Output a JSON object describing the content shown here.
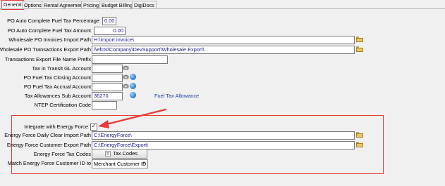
{
  "tabs": [
    {
      "label": "General",
      "active": true
    },
    {
      "label": "Options",
      "active": false
    },
    {
      "label": "Rental Agreement",
      "active": false
    },
    {
      "label": "Pricing",
      "active": false
    },
    {
      "label": "Budget Billing",
      "active": false
    },
    {
      "label": "DigiDocs",
      "active": false
    }
  ],
  "fields": {
    "po_auto_pct": {
      "label": "PO Auto Complete Fuel Tax Percentage",
      "value": "0.00"
    },
    "po_auto_amt": {
      "label": "PO Auto Complete Fuel Tax Amount",
      "value": "0.00"
    },
    "wholesale_import": {
      "label": "Wholesale PO Invoices Import Path",
      "value": "H:\\import.invoice\\"
    },
    "wholesale_export": {
      "label": "Wholesale PO Transactions Export Path",
      "value": "\\\\efcts\\Company\\DevSupport\\Wholesale Export\\"
    },
    "trans_prefix": {
      "label": "Transactions Export File Name Prefix",
      "value": ""
    },
    "tax_transit": {
      "label": "Tax in Transit GL Account",
      "value": ""
    },
    "po_fuel_closing": {
      "label": "PO Fuel Tax Closing Account",
      "value": ""
    },
    "po_fuel_accrual": {
      "label": "PO Fuel Tax Accrual Account",
      "value": ""
    },
    "tax_allow": {
      "label": "Tax Allowances Sub Account",
      "value": "36270",
      "link": "Fuel Tax Allowance"
    },
    "ntep": {
      "label": "NTEP Certification Code",
      "value": ""
    }
  },
  "energy_force": {
    "integrate_label": "Integrate with Energy Force",
    "integrate_checked": true,
    "daily_clear": {
      "label": "Energy Force Daily Clear Import Path",
      "value": "C:\\EnergyForce\\"
    },
    "customer_export": {
      "label": "Energy Force Customer Export Path",
      "value": "C:\\EnergyForce\\Export\\"
    },
    "tax_codes": {
      "label": "Energy Force Tax Codes",
      "button": "Tax Codes"
    },
    "match_id": {
      "label": "Match Energy Force Customer ID to",
      "selected": "Merchant Customer ID"
    }
  },
  "check_glyph": "✓",
  "select_arrow": "▼",
  "colors": {
    "annotation_red": "#e83a3a",
    "link_blue": "#1f3fa8",
    "value_blue": "#1a1a8c"
  },
  "icons": [
    "folder-icon",
    "gear-icon",
    "globe-icon",
    "checkbox-icon",
    "tax-codes-icon",
    "arrow-annotation"
  ]
}
